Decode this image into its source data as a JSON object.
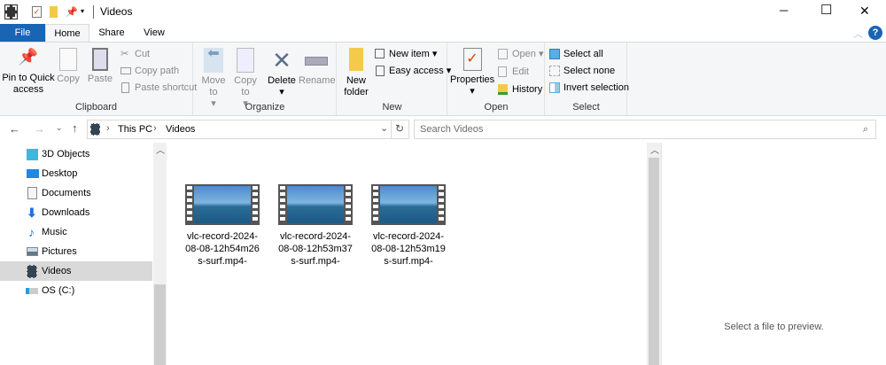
{
  "window": {
    "title": "Videos",
    "minimize": "─",
    "maximize": "☐",
    "close": "✕"
  },
  "tabs": [
    {
      "label": "File"
    },
    {
      "label": "Home"
    },
    {
      "label": "Share"
    },
    {
      "label": "View"
    }
  ],
  "ribbon": {
    "clipboard": {
      "label": "Clipboard",
      "pin": "Pin to Quick access",
      "copy": "Copy",
      "paste": "Paste",
      "cut": "Cut",
      "copy_path": "Copy path",
      "paste_shortcut": "Paste shortcut"
    },
    "organize": {
      "label": "Organize",
      "move_to": "Move to",
      "copy_to": "Copy to",
      "delete": "Delete",
      "rename": "Rename"
    },
    "new": {
      "label": "New",
      "new_folder": "New folder",
      "new_item": "New item",
      "easy_access": "Easy access"
    },
    "open": {
      "label": "Open",
      "properties": "Properties",
      "open": "Open",
      "edit": "Edit",
      "history": "History"
    },
    "select": {
      "label": "Select",
      "select_all": "Select all",
      "select_none": "Select none",
      "invert": "Invert selection"
    }
  },
  "address": {
    "crumbs": [
      "This PC",
      "Videos"
    ],
    "search_placeholder": "Search Videos"
  },
  "nav": [
    {
      "label": "3D Objects"
    },
    {
      "label": "Desktop"
    },
    {
      "label": "Documents"
    },
    {
      "label": "Downloads"
    },
    {
      "label": "Music"
    },
    {
      "label": "Pictures"
    },
    {
      "label": "Videos",
      "selected": true
    },
    {
      "label": "OS (C:)"
    }
  ],
  "files": [
    {
      "name": "vlc-record-2024-08-08-12h54m26s-surf.mp4-"
    },
    {
      "name": "vlc-record-2024-08-08-12h53m37s-surf.mp4-"
    },
    {
      "name": "vlc-record-2024-08-08-12h53m19s-surf.mp4-"
    }
  ],
  "preview": {
    "message": "Select a file to preview."
  },
  "colors": {
    "file_tab": "#1a64b4",
    "selected": "#cce8ff",
    "nav_selected": "#d9d9d9"
  }
}
